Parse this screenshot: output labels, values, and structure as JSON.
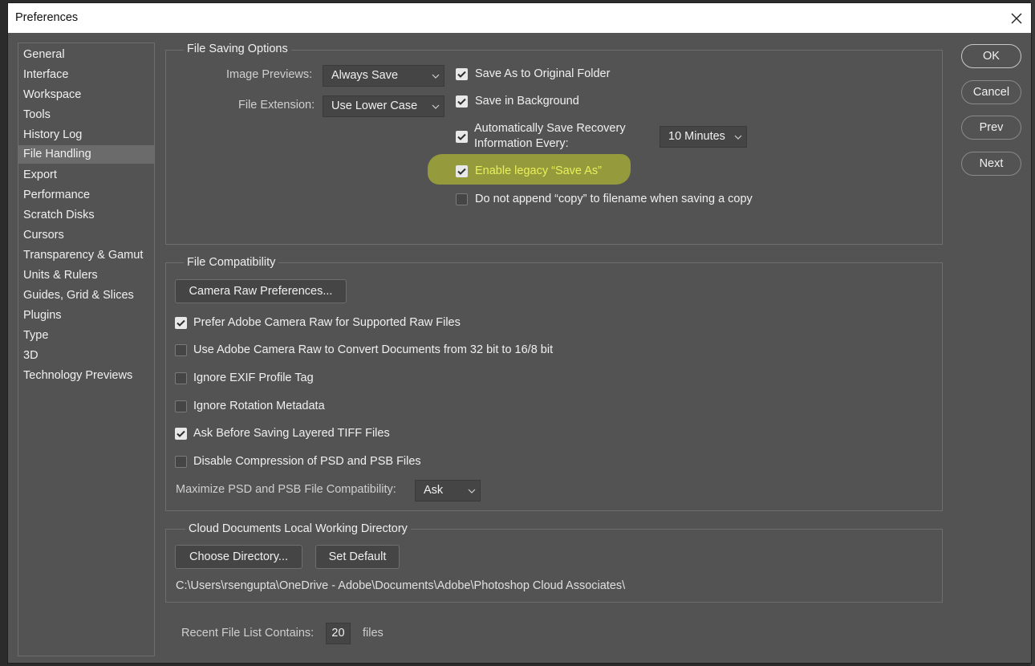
{
  "window": {
    "title": "Preferences"
  },
  "sidebar": {
    "items": [
      {
        "label": "General"
      },
      {
        "label": "Interface"
      },
      {
        "label": "Workspace"
      },
      {
        "label": "Tools"
      },
      {
        "label": "History Log"
      },
      {
        "label": "File Handling",
        "selected": true
      },
      {
        "label": "Export"
      },
      {
        "label": "Performance"
      },
      {
        "label": "Scratch Disks"
      },
      {
        "label": "Cursors"
      },
      {
        "label": "Transparency & Gamut"
      },
      {
        "label": "Units & Rulers"
      },
      {
        "label": "Guides, Grid & Slices"
      },
      {
        "label": "Plugins"
      },
      {
        "label": "Type"
      },
      {
        "label": "3D"
      },
      {
        "label": "Technology Previews"
      }
    ]
  },
  "file_saving": {
    "title": "File Saving Options",
    "image_previews_label": "Image Previews:",
    "image_previews_value": "Always Save",
    "file_extension_label": "File Extension:",
    "file_extension_value": "Use Lower Case",
    "save_original_folder": {
      "label": "Save As to Original Folder",
      "checked": true
    },
    "save_background": {
      "label": "Save in Background",
      "checked": true
    },
    "auto_recovery": {
      "label_line1": "Automatically Save Recovery",
      "label_line2": "Information Every:",
      "checked": true,
      "interval": "10 Minutes"
    },
    "legacy_save_as": {
      "label": "Enable legacy “Save As”",
      "checked": true,
      "highlight_color": "#ccd52a"
    },
    "no_copy_append": {
      "label": "Do not append “copy” to filename when saving a copy",
      "checked": false
    }
  },
  "file_compat": {
    "title": "File Compatibility",
    "camera_raw_button": "Camera Raw Preferences...",
    "prefer_acr": {
      "label": "Prefer Adobe Camera Raw for Supported Raw Files",
      "checked": true
    },
    "use_acr_convert": {
      "label": "Use Adobe Camera Raw to Convert Documents from 32 bit to 16/8 bit",
      "checked": false
    },
    "ignore_exif": {
      "label": "Ignore EXIF Profile Tag",
      "checked": false
    },
    "ignore_rotation": {
      "label": "Ignore Rotation Metadata",
      "checked": false
    },
    "ask_tiff": {
      "label": "Ask Before Saving Layered TIFF Files",
      "checked": true
    },
    "disable_compression": {
      "label": "Disable Compression of PSD and PSB Files",
      "checked": false
    },
    "maximize_label": "Maximize PSD and PSB File Compatibility:",
    "maximize_value": "Ask"
  },
  "cloud": {
    "title": "Cloud Documents Local Working Directory",
    "choose_button": "Choose Directory...",
    "default_button": "Set Default",
    "path": "C:\\Users\\rsengupta\\OneDrive - Adobe\\Documents\\Adobe\\Photoshop Cloud Associates\\"
  },
  "recent": {
    "label": "Recent File List Contains:",
    "value": "20",
    "suffix": "files"
  },
  "actions": {
    "ok": "OK",
    "cancel": "Cancel",
    "prev": "Prev",
    "next": "Next"
  },
  "icons": {
    "close": "close-icon",
    "checkmark": "checkmark-icon",
    "chevron": "chevron-down-icon"
  },
  "colors": {
    "panel_bg": "#535353",
    "selected_bg": "#6b6b6b",
    "highlight": "#ccd52a"
  }
}
